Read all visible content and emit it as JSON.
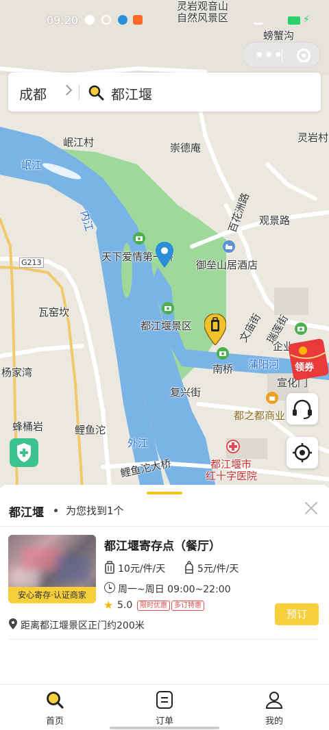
{
  "status_bar": {
    "time": "09:20"
  },
  "search": {
    "city": "成都",
    "query": "都江堰"
  },
  "map": {
    "labels": {
      "lingyan_area_1": "灵岩观音山",
      "lingyan_area_2": "自然风景区",
      "pangxiegou": "螃蟹沟",
      "lingyancun": "灵岩村",
      "minjiangcun": "岷江村",
      "chongdean": "崇德庵",
      "minjiang": "岷江",
      "baihuazhou": "百花洲路",
      "guanjinglu": "观景路",
      "g213": "G213",
      "lovers_bridge": "天下爱情第一桥",
      "yuleishan_hotel": "御垒山居酒店",
      "wawokan": "瓦窑坎",
      "wenmiao_st": "文庙街",
      "ruilian_st": "瑞莲街",
      "scenic": "都江堰景区",
      "qiye": "企业",
      "yangjiawan": "杨家湾",
      "nanqiao": "南桥",
      "puyanghe": "蒲阳河",
      "xuanhua": "宣化门",
      "fuxing_st": "复兴街",
      "fengtongyan": "蜂桶岩",
      "dzd_mall": "都之都商业",
      "liyutuo": "鲤鱼沱",
      "waijiang": "外江",
      "liyutuo_bridge": "鲤鱼沱大桥",
      "hospital_1": "都江堰市",
      "hospital_2": "红十字医院",
      "neijiang": "内江"
    }
  },
  "coupon": {
    "label": "领券"
  },
  "panel": {
    "title": "都江堰",
    "subtitle": "为您找到1个"
  },
  "store": {
    "name": "都江堰寄存点（餐厅）",
    "badge": "安心寄存·认证商家",
    "price_large": "10元/件/天",
    "price_small": "5元/件/天",
    "hours": "周一~周日 09:00~22:00",
    "rating": "5.0",
    "tags": [
      "限时优惠",
      "多订特惠"
    ],
    "book_label": "预订",
    "distance": "距离都江堰景区正门约200米"
  },
  "tabs": [
    {
      "label": "首页",
      "icon": "search-icon",
      "active": true
    },
    {
      "label": "订单",
      "icon": "order-icon",
      "active": false
    },
    {
      "label": "我的",
      "icon": "profile-icon",
      "active": false
    }
  ],
  "colors": {
    "accent": "#f6cf3a",
    "river": "#4a9bd8",
    "park": "#9ed89a",
    "tag": "#e05050"
  }
}
